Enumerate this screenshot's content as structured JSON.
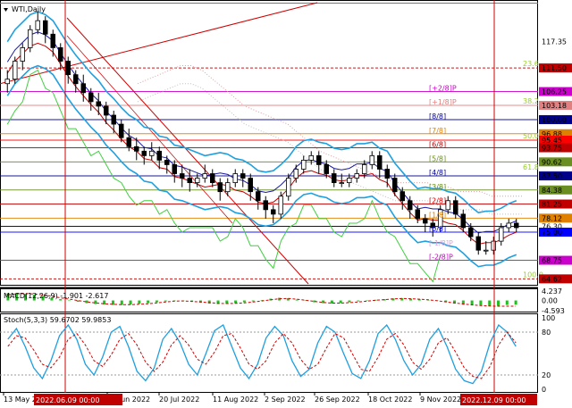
{
  "chart_data": [
    {
      "type": "line",
      "title": "WTI,Daily",
      "ylim": [
        63.5,
        126
      ],
      "x": [
        "13 May 2022",
        "28 Jun 2022",
        "20 Jul 2022",
        "11 Aug 2022",
        "2 Sep 2022",
        "26 Sep 2022",
        "18 Oct 2022",
        "9 Nov 2022"
      ],
      "price_axis_ticks": [
        {
          "label": "117.35",
          "value": 117.35
        },
        {
          "label": "111.50",
          "value": 111.5
        },
        {
          "label": "106.25",
          "value": 106.25
        },
        {
          "label": "103.18",
          "value": 103.18
        },
        {
          "label": "100.00",
          "value": 100.0
        },
        {
          "label": "96.88",
          "value": 96.88
        },
        {
          "label": "95.45",
          "value": 95.45
        },
        {
          "label": "93.75",
          "value": 93.75
        },
        {
          "label": "90.62",
          "value": 90.62
        },
        {
          "label": "87.50",
          "value": 87.5
        },
        {
          "label": "84.38",
          "value": 84.38
        },
        {
          "label": "81.25",
          "value": 81.25
        },
        {
          "label": "78.12",
          "value": 78.12
        },
        {
          "label": "76.30",
          "value": 76.3
        },
        {
          "label": "75.00",
          "value": 75.0
        },
        {
          "label": "68.75",
          "value": 68.75
        },
        {
          "label": "64.62",
          "value": 64.62
        }
      ],
      "axis_colors": {
        "111.50": "#c00000",
        "106.25": "#cc00cc",
        "103.18": "#e08080",
        "100.00": "#00008b",
        "96.88": "#e08000",
        "95.45": "#ff0000",
        "93.75": "#c00000",
        "90.62": "#6b8e23",
        "87.50": "#00008b",
        "84.38": "#6b8e23",
        "81.25": "#c00000",
        "78.12": "#e08000",
        "76.30": "#000000",
        "75.00": "#0000ff",
        "68.75": "#cc00cc",
        "64.62": "#c00000"
      },
      "murrey_labels": [
        "[+2/8]P",
        "[+1/8]P",
        "[8/8]",
        "[7/8]",
        "[6/8]",
        "[5/8]",
        "[4/8]",
        "[3/8]",
        "[2/8]",
        "[1/8]",
        "[0/8]",
        "[-1/8]P",
        "[-2/8]P"
      ],
      "fib_labels": [
        "23.6",
        "38.2",
        "50.0",
        "61.8",
        "100.0"
      ],
      "series": [
        {
          "name": "Close",
          "values": [
            109,
            113,
            116,
            120,
            122,
            119,
            116,
            113,
            110,
            108,
            106,
            104,
            103,
            101,
            99,
            96,
            94,
            93,
            92,
            93,
            91,
            90,
            88,
            87,
            86,
            87,
            88,
            86,
            84,
            86,
            88,
            87,
            84,
            82,
            80,
            79,
            83,
            87,
            89,
            91,
            92,
            90,
            88,
            86,
            86,
            87,
            88,
            90,
            92,
            89,
            87,
            84,
            82,
            80,
            78,
            77,
            76,
            80,
            82,
            79,
            76,
            74,
            71,
            71,
            73,
            76,
            77,
            76
          ]
        }
      ],
      "ohlc_data": [
        [
          108,
          111,
          106,
          109
        ],
        [
          109,
          114,
          108,
          113
        ],
        [
          113,
          117,
          111,
          116
        ],
        [
          116,
          121,
          115,
          120
        ],
        [
          120,
          124,
          119,
          122
        ],
        [
          122,
          123,
          117,
          119
        ],
        [
          119,
          120,
          114,
          116
        ],
        [
          116,
          117,
          111,
          113
        ],
        [
          113,
          114,
          108,
          110
        ],
        [
          110,
          111,
          106,
          108
        ],
        [
          108,
          110,
          104,
          106
        ],
        [
          106,
          107,
          102,
          104
        ],
        [
          104,
          106,
          101,
          103
        ],
        [
          103,
          104,
          99,
          101
        ],
        [
          101,
          102,
          97,
          99
        ],
        [
          99,
          100,
          95,
          96
        ],
        [
          96,
          98,
          93,
          94
        ],
        [
          94,
          96,
          91,
          93
        ],
        [
          93,
          94,
          90,
          92
        ],
        [
          92,
          95,
          91,
          93
        ],
        [
          93,
          94,
          89,
          91
        ],
        [
          91,
          92,
          88,
          90
        ],
        [
          90,
          91,
          86,
          88
        ],
        [
          88,
          90,
          85,
          87
        ],
        [
          87,
          89,
          84,
          86
        ],
        [
          86,
          88,
          85,
          87
        ],
        [
          87,
          90,
          86,
          88
        ],
        [
          88,
          89,
          85,
          86
        ],
        [
          86,
          87,
          82,
          84
        ],
        [
          84,
          87,
          83,
          86
        ],
        [
          86,
          89,
          85,
          88
        ],
        [
          88,
          89,
          85,
          87
        ],
        [
          87,
          88,
          82,
          84
        ],
        [
          84,
          85,
          80,
          82
        ],
        [
          82,
          83,
          78,
          80
        ],
        [
          80,
          81,
          77,
          79
        ],
        [
          79,
          84,
          78,
          83
        ],
        [
          83,
          88,
          82,
          87
        ],
        [
          87,
          90,
          86,
          89
        ],
        [
          89,
          92,
          88,
          91
        ],
        [
          91,
          93,
          90,
          92
        ],
        [
          92,
          93,
          88,
          90
        ],
        [
          90,
          91,
          87,
          88
        ],
        [
          88,
          89,
          85,
          86
        ],
        [
          86,
          88,
          85,
          86
        ],
        [
          86,
          88,
          85,
          87
        ],
        [
          87,
          89,
          86,
          88
        ],
        [
          88,
          91,
          87,
          90
        ],
        [
          90,
          93,
          89,
          92
        ],
        [
          92,
          93,
          87,
          89
        ],
        [
          89,
          90,
          85,
          87
        ],
        [
          87,
          88,
          83,
          84
        ],
        [
          84,
          85,
          80,
          82
        ],
        [
          82,
          83,
          78,
          80
        ],
        [
          80,
          81,
          77,
          78
        ],
        [
          78,
          79,
          75,
          77
        ],
        [
          77,
          78,
          74,
          76
        ],
        [
          76,
          81,
          75,
          80
        ],
        [
          80,
          83,
          79,
          82
        ],
        [
          82,
          83,
          78,
          79
        ],
        [
          79,
          80,
          75,
          76
        ],
        [
          76,
          77,
          73,
          74
        ],
        [
          74,
          75,
          70,
          71
        ],
        [
          71,
          73,
          70,
          71
        ],
        [
          71,
          74,
          70,
          73
        ],
        [
          73,
          77,
          72,
          76
        ],
        [
          76,
          78,
          75,
          77
        ],
        [
          77,
          78,
          75,
          76
        ]
      ]
    },
    {
      "type": "bar",
      "title": "MACD(12,26,9) -1.901 -2.617",
      "ylim": [
        -4.593,
        4.237
      ],
      "ticks": [
        {
          "label": "4.237",
          "value": 4.237
        },
        {
          "label": "0.00",
          "value": 0.0
        },
        {
          "label": "-4.593",
          "value": -4.593
        }
      ],
      "series": [
        {
          "name": "MACD",
          "values": [
            3.2,
            3.4,
            3.0,
            2.6,
            2.0,
            1.2,
            0.6,
            0.0,
            -0.6,
            -1.2,
            -1.6,
            -1.8,
            -2.0,
            -2.0,
            -1.8,
            -1.5,
            -1.2,
            -0.8,
            -0.4,
            0.0,
            -0.2,
            -0.6,
            -1.0,
            -1.4,
            -1.6,
            -1.5,
            -1.2,
            -0.8,
            -0.4,
            0.2,
            0.8,
            1.2,
            1.0,
            0.4,
            -0.2,
            -0.8,
            -1.2,
            -1.4,
            -1.2,
            -0.8,
            -0.4,
            0.0,
            0.3,
            0.6,
            0.9,
            1.0,
            0.8,
            0.5,
            0.2,
            -0.2,
            -0.8,
            -1.4,
            -1.9,
            -2.2,
            -2.4,
            -2.6,
            -2.4,
            -2.0,
            -1.9
          ]
        },
        {
          "name": "Signal",
          "values": [
            2.6,
            3.0,
            3.1,
            2.9,
            2.5,
            1.9,
            1.2,
            0.6,
            0.0,
            -0.6,
            -1.1,
            -1.5,
            -1.7,
            -1.9,
            -1.9,
            -1.7,
            -1.5,
            -1.1,
            -0.7,
            -0.3,
            -0.2,
            -0.4,
            -0.7,
            -1.0,
            -1.3,
            -1.4,
            -1.3,
            -1.1,
            -0.7,
            -0.2,
            0.3,
            0.8,
            0.9,
            0.6,
            0.1,
            -0.4,
            -0.9,
            -1.2,
            -1.2,
            -1.0,
            -0.7,
            -0.3,
            0.1,
            0.4,
            0.7,
            0.9,
            0.8,
            0.6,
            0.3,
            -0.1,
            -0.6,
            -1.1,
            -1.6,
            -2.0,
            -2.3,
            -2.5,
            -2.6,
            -2.6,
            -2.6
          ]
        }
      ]
    },
    {
      "type": "line",
      "title": "Stoch(5,3,3) 59.6702 59.9853",
      "ylim": [
        0,
        100
      ],
      "ticks": [
        {
          "label": "100",
          "value": 100
        },
        {
          "label": "80",
          "value": 80
        },
        {
          "label": "20",
          "value": 20
        },
        {
          "label": "0",
          "value": 0
        }
      ],
      "series": [
        {
          "name": "%K",
          "values": [
            70,
            85,
            60,
            30,
            15,
            40,
            75,
            90,
            70,
            35,
            20,
            45,
            80,
            88,
            60,
            25,
            12,
            30,
            70,
            85,
            65,
            35,
            20,
            50,
            82,
            90,
            60,
            30,
            15,
            35,
            72,
            88,
            75,
            40,
            18,
            28,
            65,
            88,
            80,
            50,
            22,
            15,
            40,
            78,
            90,
            70,
            40,
            20,
            35,
            70,
            85,
            60,
            28,
            12,
            8,
            25,
            65,
            90,
            80,
            60
          ]
        },
        {
          "name": "%D",
          "values": [
            60,
            75,
            72,
            55,
            35,
            30,
            45,
            70,
            78,
            62,
            40,
            32,
            48,
            70,
            78,
            62,
            38,
            25,
            38,
            62,
            75,
            62,
            42,
            35,
            52,
            75,
            78,
            58,
            35,
            28,
            40,
            65,
            78,
            65,
            42,
            28,
            35,
            58,
            78,
            72,
            50,
            28,
            25,
            45,
            70,
            78,
            62,
            38,
            28,
            42,
            65,
            72,
            52,
            30,
            18,
            15,
            32,
            62,
            80,
            65
          ]
        }
      ]
    }
  ],
  "time_markers": {
    "left": "2022.06.09 00:00",
    "right": "2022.12.09 00:00"
  }
}
